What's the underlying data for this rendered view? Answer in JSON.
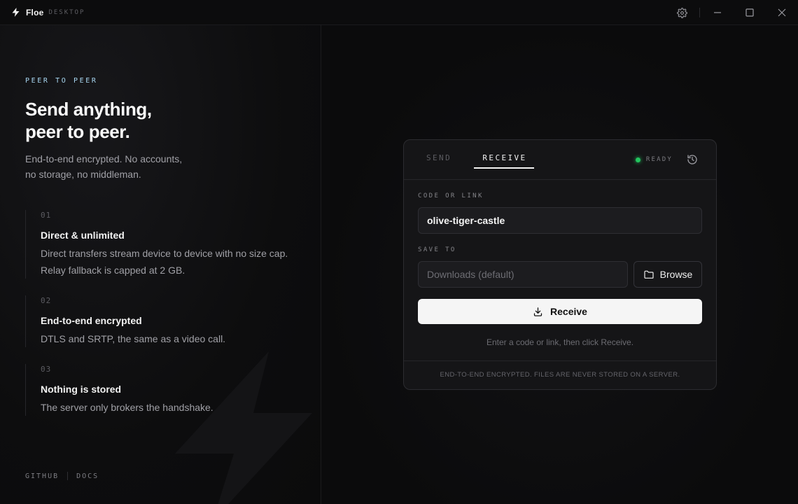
{
  "app": {
    "name": "Floe",
    "subtitle": "DESKTOP"
  },
  "left": {
    "eyebrow": "PEER TO PEER",
    "headline": [
      "Send anything,",
      "peer to peer."
    ],
    "intro": [
      "End-to-end encrypted. No accounts,",
      "no storage, no middleman."
    ],
    "features": [
      {
        "num": "01",
        "title": "Direct & unlimited",
        "desc": [
          "Direct transfers stream device to device with no size cap.",
          "Relay fallback is capped at 2 GB."
        ]
      },
      {
        "num": "02",
        "title": "End-to-end encrypted",
        "desc": [
          "DTLS and SRTP, the same as a video call."
        ]
      },
      {
        "num": "03",
        "title": "Nothing is stored",
        "desc": [
          "The server only brokers the handshake."
        ]
      }
    ],
    "footer_links": [
      "GITHUB",
      "DOCS"
    ]
  },
  "card": {
    "tabs": [
      "SEND",
      "RECEIVE"
    ],
    "active_tab": "RECEIVE",
    "status": "READY",
    "code_label": "CODE OR LINK",
    "code_value": "olive-tiger-castle",
    "save_label": "SAVE TO",
    "save_placeholder": "Downloads (default)",
    "browse_label": "Browse",
    "receive_label": "Receive",
    "hint": "Enter a code or link, then click Receive.",
    "footer": "END-TO-END ENCRYPTED. FILES ARE NEVER STORED ON A SERVER."
  },
  "icons": {
    "brand": "bolt-icon",
    "settings": "gear-icon",
    "minimize": "minimize-icon",
    "maximize": "maximize-icon",
    "close": "close-icon",
    "history": "history-icon",
    "browse": "folder-icon",
    "receive": "download-icon"
  },
  "colors": {
    "accent_eyebrow": "#a9d7f2",
    "status_green": "#22c55e",
    "primary_button": "#f5f5f5"
  }
}
